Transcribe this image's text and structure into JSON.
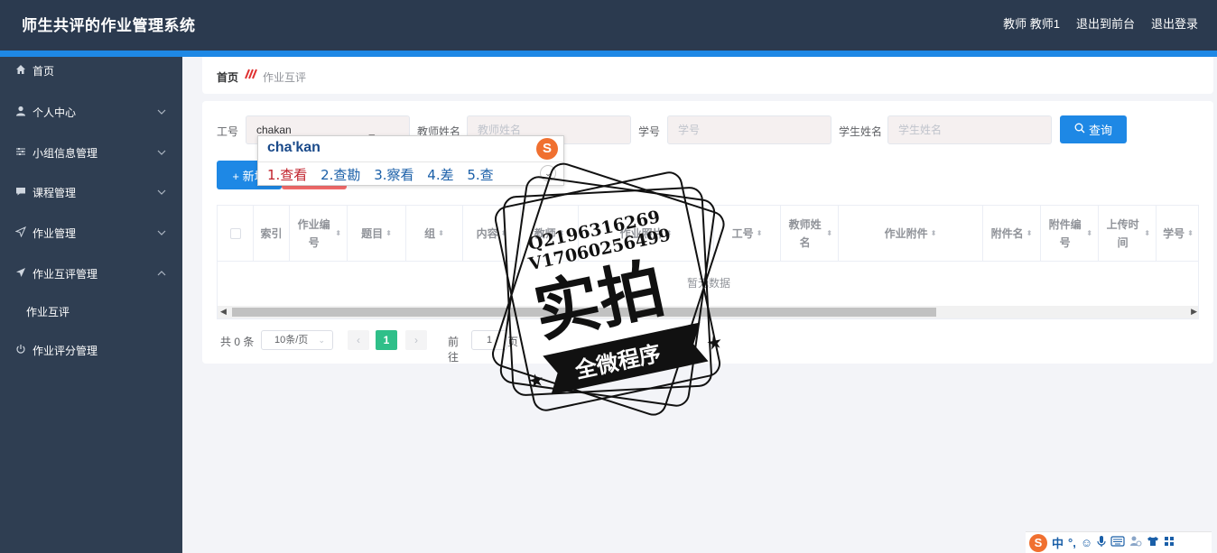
{
  "header": {
    "title": "师生共评的作业管理系统",
    "user": "教师 教师1",
    "to_front": "退出到前台",
    "logout": "退出登录"
  },
  "sidebar": {
    "items": [
      {
        "label": "首页",
        "icon": "home-icon"
      },
      {
        "label": "个人中心",
        "icon": "user-icon"
      },
      {
        "label": "小组信息管理",
        "icon": "sliders-icon"
      },
      {
        "label": "课程管理",
        "icon": "message-icon"
      },
      {
        "label": "作业管理",
        "icon": "send-icon"
      },
      {
        "label": "作业互评管理",
        "icon": "send-filled-icon"
      },
      {
        "label": "作业互评",
        "icon": ""
      },
      {
        "label": "作业评分管理",
        "icon": "power-icon"
      }
    ]
  },
  "breadcrumb": {
    "home": "首页",
    "current": "作业互评"
  },
  "search": {
    "field1_label": "工号",
    "field1_value": "chakan",
    "field2_label": "教师姓名",
    "field2_placeholder": "教师姓名",
    "field3_label": "学号",
    "field3_placeholder": "学号",
    "field4_label": "学生姓名",
    "field4_placeholder": "学生姓名",
    "search_button": "查询"
  },
  "actions": {
    "add": "+ 新增",
    "delete": "删除"
  },
  "table": {
    "columns": [
      "索引",
      "作业编号",
      "题目",
      "组",
      "内容",
      "教师",
      "作业照片",
      "工号",
      "教师姓名",
      "作业附件",
      "附件名",
      "附件编号",
      "上传时间",
      "学号"
    ],
    "empty_text": "暂无数据"
  },
  "pagination": {
    "total": "共 0 条",
    "page_size": "10条/页",
    "current_page": "1",
    "goto_label": "前往",
    "goto_value": "1",
    "page_word": "页"
  },
  "ime": {
    "pinyin": "cha'kan",
    "candidates": [
      "1.查看",
      "2.查勘",
      "3.察看",
      "4.差",
      "5.查"
    ]
  },
  "watermark": {
    "line1": "Q2196316269",
    "line2": "V17060256499",
    "main": "实拍",
    "ribbon": "全微程序"
  },
  "imebar": {
    "mode": "中",
    "punct": "°,"
  }
}
